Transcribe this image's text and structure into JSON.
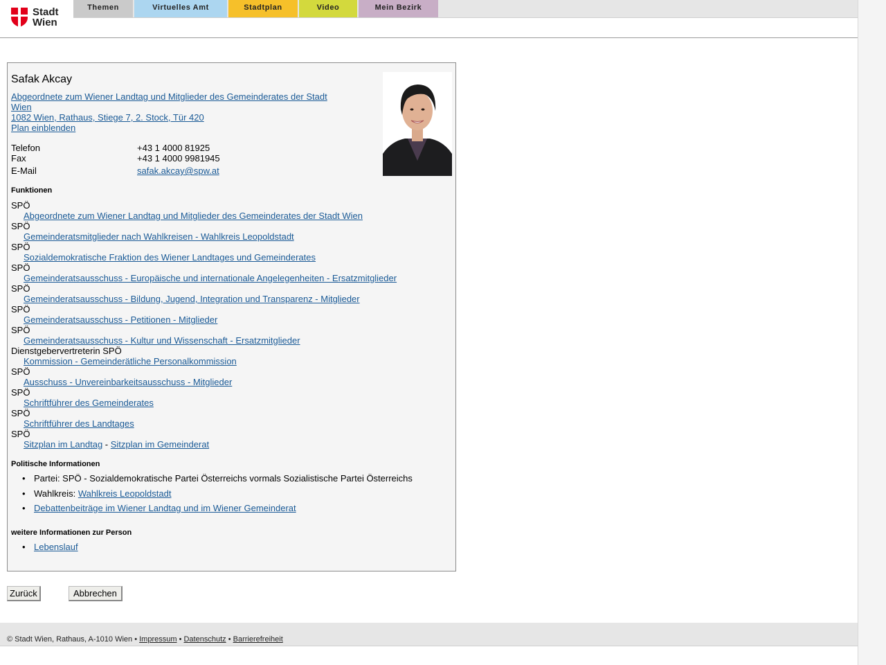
{
  "header": {
    "logo_line1": "Stadt",
    "logo_line2": "Wien",
    "tabs": [
      "Themen",
      "Virtuelles Amt",
      "Stadtplan",
      "Video",
      "Mein Bezirk"
    ]
  },
  "person": {
    "name": "Safak Akcay",
    "role_line1": "Abgeordnete zum Wiener Landtag und Mitglieder des Gemeinderates der Stadt",
    "role_line2": "Wien ",
    "address": "1082 Wien, Rathaus, Stiege 7, 2. Stock, Tür 420",
    "map_link": "Plan einblenden",
    "telefon_label": "Telefon",
    "telefon": "+43 1 4000 81925",
    "fax_label": "Fax",
    "fax": "+43 1 4000 9981945",
    "email_label": "E-Mail",
    "email": "safak.akcay@spw.at"
  },
  "funktionen": {
    "heading": "Funktionen",
    "items": [
      {
        "role": "SPÖ",
        "link": "Abgeordnete zum Wiener Landtag und Mitglieder des Gemeinderates der Stadt Wien"
      },
      {
        "role": "SPÖ",
        "link": "Gemeinderatsmitglieder nach Wahlkreisen - Wahlkreis Leopoldstadt"
      },
      {
        "role": "SPÖ",
        "link": "Sozialdemokratische Fraktion des Wiener Landtages und Gemeinderates"
      },
      {
        "role": "SPÖ",
        "link": "Gemeinderatsausschuss - Europäische und internationale Angelegenheiten - Ersatzmitglieder"
      },
      {
        "role": "SPÖ",
        "link": "Gemeinderatsausschuss - Bildung, Jugend, Integration und Transparenz - Mitglieder"
      },
      {
        "role": "SPÖ",
        "link": "Gemeinderatsausschuss - Petitionen - Mitglieder"
      },
      {
        "role": "SPÖ",
        "link": "Gemeinderatsausschuss - Kultur und Wissenschaft - Ersatzmitglieder"
      },
      {
        "role": "Dienstgebervertreterin SPÖ",
        "link": "Kommission - Gemeinderätliche Personalkommission"
      },
      {
        "role": "SPÖ",
        "link": "Ausschuss - Unvereinbarkeitsausschuss - Mitglieder"
      },
      {
        "role": "SPÖ",
        "link": "Schriftführer des Gemeinderates"
      },
      {
        "role": "SPÖ",
        "link": "Schriftführer des Landtages"
      }
    ],
    "last_role": "SPÖ",
    "sitzplan_landtag": "Sitzplan im Landtag",
    "sitzplan_sep": " - ",
    "sitzplan_gemeinderat": "Sitzplan im Gemeinderat"
  },
  "politisch": {
    "heading": "Politische Informationen",
    "partei": "Partei: SPÖ - Sozialdemokratische Partei Österreichs vormals Sozialistische Partei Österreichs",
    "wahlkreis_label": "Wahlkreis: ",
    "wahlkreis_link": "Wahlkreis Leopoldstadt",
    "debatten_link": "Debattenbeiträge im Wiener Landtag und im Wiener Gemeinderat"
  },
  "weitere": {
    "heading": "weitere Informationen zur Person",
    "lebenslauf": "Lebenslauf"
  },
  "buttons": {
    "back": "Zurück",
    "cancel": "Abbrechen"
  },
  "footer": {
    "copyright": "© Stadt Wien, Rathaus, A-1010 Wien",
    "sep": " • ",
    "impressum": "Impressum",
    "datenschutz": "Datenschutz",
    "barrierefreiheit": "Barrierefreiheit"
  },
  "colors": {
    "link": "#1a5a96",
    "logo_red": "#e2001a",
    "tab_themen": "#cacaca",
    "tab_virtuelles_amt": "#acd6f0",
    "tab_stadtplan": "#f6c02a",
    "tab_video": "#d3d93d",
    "tab_mein_bezirk": "#c8aec6"
  }
}
